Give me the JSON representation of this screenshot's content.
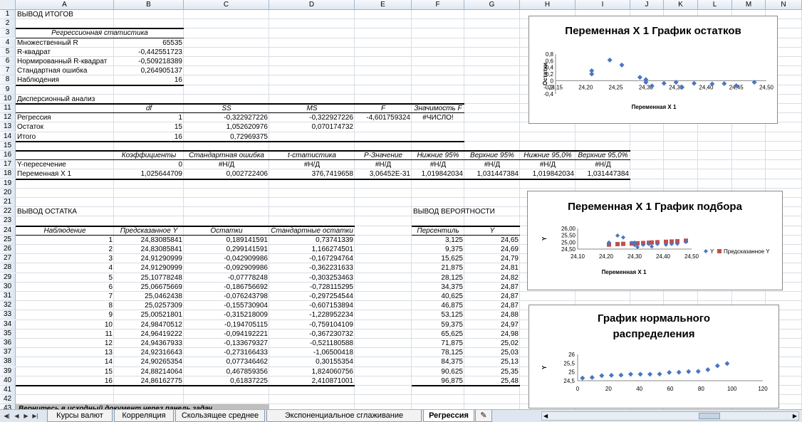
{
  "columns": [
    "A",
    "B",
    "C",
    "D",
    "E",
    "F",
    "G",
    "H",
    "I",
    "J",
    "K",
    "L",
    "M",
    "N"
  ],
  "rows_count": 44,
  "cells": [
    {
      "row": 1,
      "col": "A",
      "text": "ВЫВОД ИТОГОВ"
    },
    {
      "row": 3,
      "col": "A",
      "text": "Регрессионная статистика",
      "span": 2,
      "align": "c",
      "italic": true
    },
    {
      "row": 4,
      "col": "A",
      "text": "Множественный R"
    },
    {
      "row": 4,
      "col": "B",
      "text": "65535",
      "align": "r"
    },
    {
      "row": 5,
      "col": "A",
      "text": "R-квадрат"
    },
    {
      "row": 5,
      "col": "B",
      "text": "-0,442551723",
      "align": "r"
    },
    {
      "row": 6,
      "col": "A",
      "text": "Нормированный R-квадрат"
    },
    {
      "row": 6,
      "col": "B",
      "text": "-0,509218389",
      "align": "r"
    },
    {
      "row": 7,
      "col": "A",
      "text": "Стандартная ошибка"
    },
    {
      "row": 7,
      "col": "B",
      "text": "0,264905137",
      "align": "r"
    },
    {
      "row": 8,
      "col": "A",
      "text": "Наблюдения"
    },
    {
      "row": 8,
      "col": "B",
      "text": "16",
      "align": "r"
    },
    {
      "row": 10,
      "col": "A",
      "text": "Дисперсионный анализ"
    },
    {
      "row": 11,
      "col": "B",
      "text": "df",
      "align": "c",
      "italic": true
    },
    {
      "row": 11,
      "col": "C",
      "text": "SS",
      "align": "c",
      "italic": true
    },
    {
      "row": 11,
      "col": "D",
      "text": "MS",
      "align": "c",
      "italic": true
    },
    {
      "row": 11,
      "col": "E",
      "text": "F",
      "align": "c",
      "italic": true
    },
    {
      "row": 11,
      "col": "F",
      "text": "Значимость F",
      "align": "c",
      "italic": true
    },
    {
      "row": 12,
      "col": "A",
      "text": "Регрессия"
    },
    {
      "row": 12,
      "col": "B",
      "text": "1",
      "align": "r"
    },
    {
      "row": 12,
      "col": "C",
      "text": "-0,322927226",
      "align": "r"
    },
    {
      "row": 12,
      "col": "D",
      "text": "-0,322927226",
      "align": "r"
    },
    {
      "row": 12,
      "col": "E",
      "text": "-4,601759324",
      "align": "r"
    },
    {
      "row": 12,
      "col": "F",
      "text": "#ЧИСЛО!",
      "align": "c"
    },
    {
      "row": 13,
      "col": "A",
      "text": "Остаток"
    },
    {
      "row": 13,
      "col": "B",
      "text": "15",
      "align": "r"
    },
    {
      "row": 13,
      "col": "C",
      "text": "1,052620976",
      "align": "r"
    },
    {
      "row": 13,
      "col": "D",
      "text": "0,070174732",
      "align": "r"
    },
    {
      "row": 14,
      "col": "A",
      "text": "Итого"
    },
    {
      "row": 14,
      "col": "B",
      "text": "16",
      "align": "r"
    },
    {
      "row": 14,
      "col": "C",
      "text": "0,72969375",
      "align": "r"
    },
    {
      "row": 16,
      "col": "B",
      "text": "Коэффициенты",
      "align": "c",
      "italic": true
    },
    {
      "row": 16,
      "col": "C",
      "text": "Стандартная ошибка",
      "align": "c",
      "italic": true
    },
    {
      "row": 16,
      "col": "D",
      "text": "t-статистика",
      "align": "c",
      "italic": true
    },
    {
      "row": 16,
      "col": "E",
      "text": "P-Значение",
      "align": "c",
      "italic": true
    },
    {
      "row": 16,
      "col": "F",
      "text": "Нижние 95%",
      "align": "c",
      "italic": true
    },
    {
      "row": 16,
      "col": "G",
      "text": "Верхние 95%",
      "align": "c",
      "italic": true
    },
    {
      "row": 16,
      "col": "H",
      "text": "Нижние 95,0%",
      "align": "c",
      "italic": true
    },
    {
      "row": 16,
      "col": "I",
      "text": "Верхние 95,0%",
      "align": "c",
      "italic": true
    },
    {
      "row": 17,
      "col": "A",
      "text": "Y-пересечение"
    },
    {
      "row": 17,
      "col": "B",
      "text": "0",
      "align": "r"
    },
    {
      "row": 17,
      "col": "C",
      "text": "#Н/Д",
      "align": "c"
    },
    {
      "row": 17,
      "col": "D",
      "text": "#Н/Д",
      "align": "c"
    },
    {
      "row": 17,
      "col": "E",
      "text": "#Н/Д",
      "align": "c"
    },
    {
      "row": 17,
      "col": "F",
      "text": "#Н/Д",
      "align": "c"
    },
    {
      "row": 17,
      "col": "G",
      "text": "#Н/Д",
      "align": "c"
    },
    {
      "row": 17,
      "col": "H",
      "text": "#Н/Д",
      "align": "c"
    },
    {
      "row": 17,
      "col": "I",
      "text": "#Н/Д",
      "align": "c"
    },
    {
      "row": 18,
      "col": "A",
      "text": "Переменная X 1"
    },
    {
      "row": 18,
      "col": "B",
      "text": "1,025644709",
      "align": "r"
    },
    {
      "row": 18,
      "col": "C",
      "text": "0,002722406",
      "align": "r"
    },
    {
      "row": 18,
      "col": "D",
      "text": "376,7419658",
      "align": "r"
    },
    {
      "row": 18,
      "col": "E",
      "text": "3,06452E-31",
      "align": "r"
    },
    {
      "row": 18,
      "col": "F",
      "text": "1,019842034",
      "align": "r"
    },
    {
      "row": 18,
      "col": "G",
      "text": "1,031447384",
      "align": "r"
    },
    {
      "row": 18,
      "col": "H",
      "text": "1,019842034",
      "align": "r"
    },
    {
      "row": 18,
      "col": "I",
      "text": "1,031447384",
      "align": "r"
    },
    {
      "row": 22,
      "col": "A",
      "text": "ВЫВОД ОСТАТКА"
    },
    {
      "row": 22,
      "col": "F",
      "text": "ВЫВОД ВЕРОЯТНОСТИ"
    },
    {
      "row": 24,
      "col": "A",
      "text": "Наблюдение",
      "align": "c",
      "italic": true
    },
    {
      "row": 24,
      "col": "B",
      "text": "Предсказанное Y",
      "align": "c",
      "italic": true
    },
    {
      "row": 24,
      "col": "C",
      "text": "Остатки",
      "align": "c",
      "italic": true
    },
    {
      "row": 24,
      "col": "D",
      "text": "Стандартные остатки",
      "align": "c",
      "italic": true
    },
    {
      "row": 24,
      "col": "F",
      "text": "Персентиль",
      "align": "c",
      "italic": true
    },
    {
      "row": 24,
      "col": "G",
      "text": "Y",
      "align": "c",
      "italic": true
    }
  ],
  "residual_rows": [
    [
      "1",
      "24,83085841",
      "0,189141591",
      "0,73741339",
      "3,125",
      "24,65"
    ],
    [
      "2",
      "24,83085841",
      "0,299141591",
      "1,166274501",
      "9,375",
      "24,69"
    ],
    [
      "3",
      "24,91290999",
      "-0,042909986",
      "-0,167294764",
      "15,625",
      "24,79"
    ],
    [
      "4",
      "24,91290999",
      "-0,092909986",
      "-0,362231633",
      "21,875",
      "24,81"
    ],
    [
      "5",
      "25,10778248",
      "-0,07778248",
      "-0,303253463",
      "28,125",
      "24,82"
    ],
    [
      "6",
      "25,06675669",
      "-0,186756692",
      "-0,728115295",
      "34,375",
      "24,87"
    ],
    [
      "7",
      "25,0462438",
      "-0,076243798",
      "-0,297254544",
      "40,625",
      "24,87"
    ],
    [
      "8",
      "25,0257309",
      "-0,155730904",
      "-0,607153894",
      "46,875",
      "24,87"
    ],
    [
      "9",
      "25,00521801",
      "-0,315218009",
      "-1,228952234",
      "53,125",
      "24,88"
    ],
    [
      "10",
      "24,98470512",
      "-0,194705115",
      "-0,759104109",
      "59,375",
      "24,97"
    ],
    [
      "11",
      "24,96419222",
      "-0,094192221",
      "-0,367230732",
      "65,625",
      "24,98"
    ],
    [
      "12",
      "24,94367933",
      "-0,133679327",
      "-0,521180588",
      "71,875",
      "25,02"
    ],
    [
      "13",
      "24,92316643",
      "-0,273166433",
      "-1,06500418",
      "78,125",
      "25,03"
    ],
    [
      "14",
      "24,90265354",
      "0,077346462",
      "0,30155354",
      "84,375",
      "25,13"
    ],
    [
      "15",
      "24,88214064",
      "0,467859356",
      "1,824060756",
      "90,625",
      "25,35"
    ],
    [
      "16",
      "24,86162775",
      "0,61837225",
      "2,410871001",
      "96,875",
      "25,48"
    ]
  ],
  "footer_note": "Вернитесь в исходный документ через панель задач",
  "charts": {
    "residuals": {
      "title": "Переменная X 1 График остатков",
      "ylabel": "Остатки",
      "xlabel": "Переменная  X 1",
      "yticks": [
        "0,8",
        "0,6",
        "0,4",
        "0,2",
        "0",
        "-0,2",
        "-0,4"
      ],
      "xticks": [
        "24,15",
        "24,20",
        "24,25",
        "24,30",
        "24,35",
        "24,40",
        "24,45",
        "24,50"
      ]
    },
    "fit": {
      "title": "Переменная X 1 График подбора",
      "ylabel": "Y",
      "xlabel": "Переменная  X 1",
      "yticks": [
        "26,00",
        "25,50",
        "25,00",
        "24,50"
      ],
      "xticks": [
        "24,10",
        "24,20",
        "24,30",
        "24,40",
        "24,50"
      ],
      "legend_y": "Y",
      "legend_pred": "Предсказанное Y"
    },
    "normal": {
      "title_line1": "График нормального",
      "title_line2": "распределения",
      "ylabel": "Y",
      "yticks": [
        "26",
        "25,5",
        "25",
        "24,5"
      ],
      "xticks": [
        "0",
        "20",
        "40",
        "60",
        "80",
        "100",
        "120"
      ]
    }
  },
  "chart_data": [
    {
      "type": "scatter",
      "title": "Переменная X 1 График остатков",
      "xlabel": "Переменная  X 1",
      "ylabel": "Остатки",
      "xlim": [
        24.15,
        24.5
      ],
      "ylim": [
        -0.4,
        0.8
      ],
      "series": [
        {
          "x": [
            24.21,
            24.21,
            24.24,
            24.26,
            24.29,
            24.3,
            24.3,
            24.31,
            24.33,
            24.35,
            24.36,
            24.38,
            24.41,
            24.43,
            24.45,
            24.48
          ],
          "y": [
            0.3,
            0.2,
            0.62,
            0.47,
            0.1,
            0.03,
            -0.05,
            -0.16,
            -0.08,
            -0.05,
            -0.2,
            -0.08,
            -0.1,
            -0.09,
            -0.15,
            -0.05
          ]
        }
      ],
      "color": "#4a75c2"
    },
    {
      "type": "scatter",
      "title": "Переменная X 1 График подбора",
      "xlabel": "Переменная  X 1",
      "ylabel": "Y",
      "xlim": [
        24.1,
        24.5
      ],
      "ylim": [
        24.5,
        26.0
      ],
      "series": [
        {
          "name": "Y",
          "x": [
            24.21,
            24.21,
            24.24,
            24.26,
            24.29,
            24.3,
            24.3,
            24.31,
            24.33,
            24.35,
            24.36,
            24.38,
            24.41,
            24.43,
            24.45,
            24.48
          ],
          "y": [
            24.98,
            24.94,
            25.48,
            25.35,
            24.95,
            24.97,
            24.79,
            24.65,
            24.81,
            24.87,
            24.69,
            24.87,
            24.82,
            24.87,
            24.88,
            25.02
          ],
          "color": "#4a75c2"
        },
        {
          "name": "Предсказанное Y",
          "x": [
            24.21,
            24.21,
            24.24,
            24.26,
            24.29,
            24.3,
            24.3,
            24.31,
            24.33,
            24.35,
            24.36,
            24.38,
            24.41,
            24.43,
            24.45,
            24.48
          ],
          "y": [
            24.83,
            24.83,
            24.86,
            24.88,
            24.9,
            24.91,
            24.91,
            24.92,
            24.94,
            24.96,
            24.98,
            25.0,
            25.03,
            25.05,
            25.07,
            25.11
          ],
          "color": "#c0504d"
        }
      ]
    },
    {
      "type": "scatter",
      "title": "График нормального распределения",
      "ylabel": "Y",
      "xlim": [
        0,
        120
      ],
      "ylim": [
        24.5,
        26
      ],
      "series": [
        {
          "x": [
            3.125,
            9.375,
            15.625,
            21.875,
            28.125,
            34.375,
            40.625,
            46.875,
            53.125,
            59.375,
            65.625,
            71.875,
            78.125,
            84.375,
            90.625,
            96.875
          ],
          "y": [
            24.65,
            24.69,
            24.79,
            24.81,
            24.82,
            24.87,
            24.87,
            24.87,
            24.88,
            24.97,
            24.98,
            25.02,
            25.03,
            25.13,
            25.35,
            25.48
          ]
        }
      ],
      "color": "#4a75c2"
    }
  ],
  "tabs": [
    {
      "label": "Курсы валют",
      "active": false
    },
    {
      "label": "Корреляция",
      "active": false
    },
    {
      "label": "Скользящее среднее",
      "active": false
    },
    {
      "label": "Экспоненциальное сглаживание",
      "active": false
    },
    {
      "label": "Регрессия",
      "active": true
    }
  ]
}
